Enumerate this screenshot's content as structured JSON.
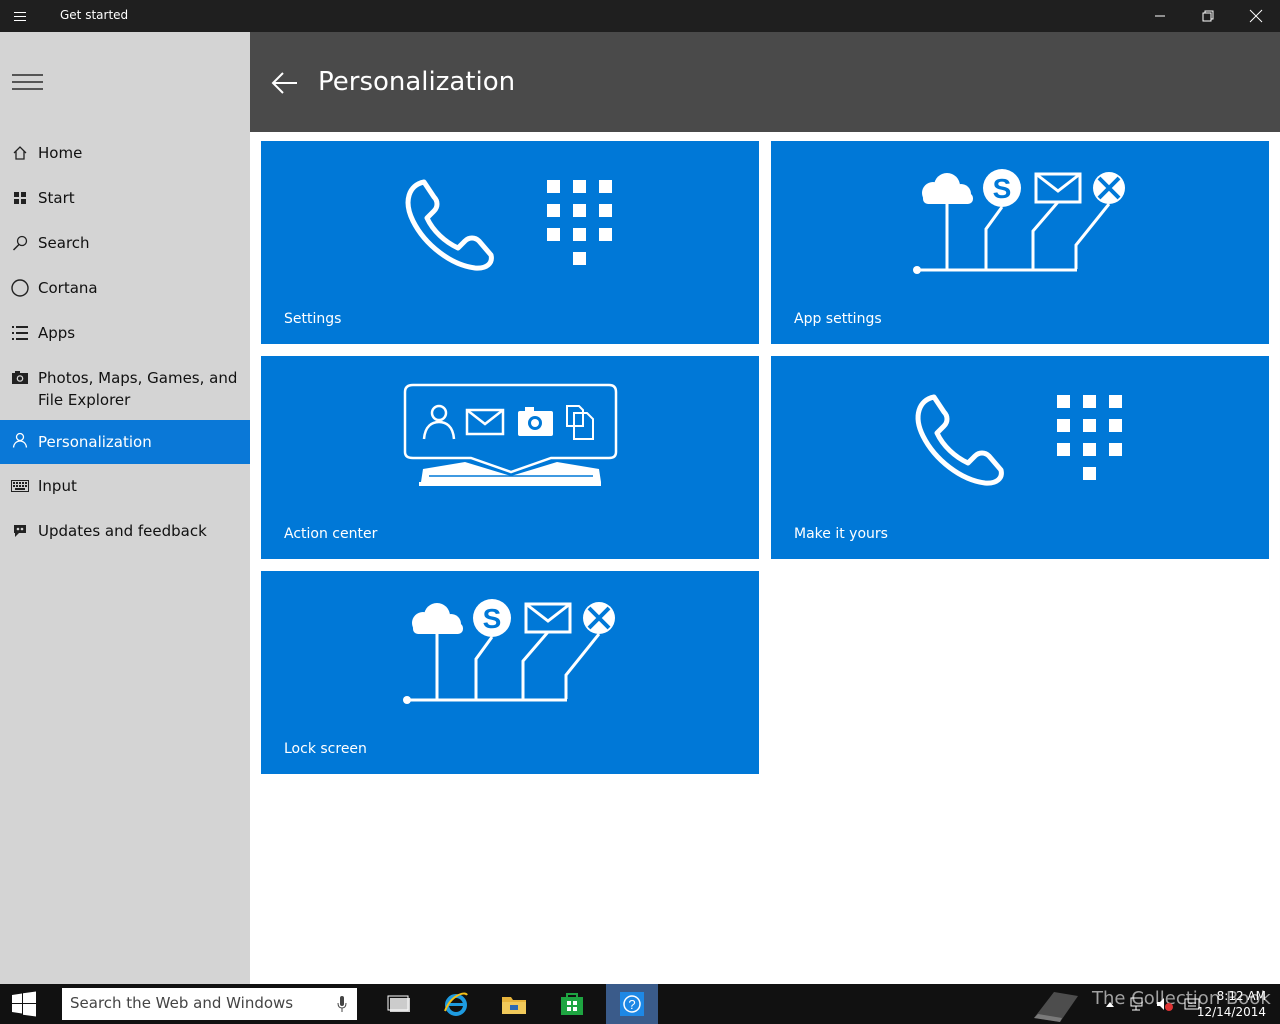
{
  "window": {
    "title": "Get started"
  },
  "sidebar": {
    "items": [
      {
        "label": "Home",
        "icon": "home-icon"
      },
      {
        "label": "Start",
        "icon": "start-grid-icon"
      },
      {
        "label": "Search",
        "icon": "search-icon"
      },
      {
        "label": "Cortana",
        "icon": "cortana-circle-icon"
      },
      {
        "label": "Apps",
        "icon": "apps-list-icon"
      },
      {
        "label": "Photos, Maps, Games, and",
        "label2": "File Explorer",
        "icon": "camera-icon"
      },
      {
        "label": "Personalization",
        "icon": "person-icon",
        "active": true
      },
      {
        "label": "Input",
        "icon": "keyboard-icon"
      },
      {
        "label": "Updates and feedback",
        "icon": "feedback-icon"
      }
    ]
  },
  "header": {
    "title": "Personalization"
  },
  "tiles": [
    {
      "label": "Settings",
      "art": "phone-dialpad"
    },
    {
      "label": "App settings",
      "art": "cloud-services"
    },
    {
      "label": "Action center",
      "art": "action-center"
    },
    {
      "label": "Make it yours",
      "art": "phone-dialpad"
    },
    {
      "label": "Lock screen",
      "art": "cloud-services"
    }
  ],
  "taskbar": {
    "search_placeholder": "Search the Web and Windows",
    "time": "8:12 AM",
    "date": "12/14/2014",
    "watermark": "The Collection Book"
  },
  "colors": {
    "accent": "#0078d7",
    "sidebar_bg": "#d4d4d4",
    "header_bg": "#4a4a4a",
    "titlebar_bg": "#1f1f1f"
  }
}
